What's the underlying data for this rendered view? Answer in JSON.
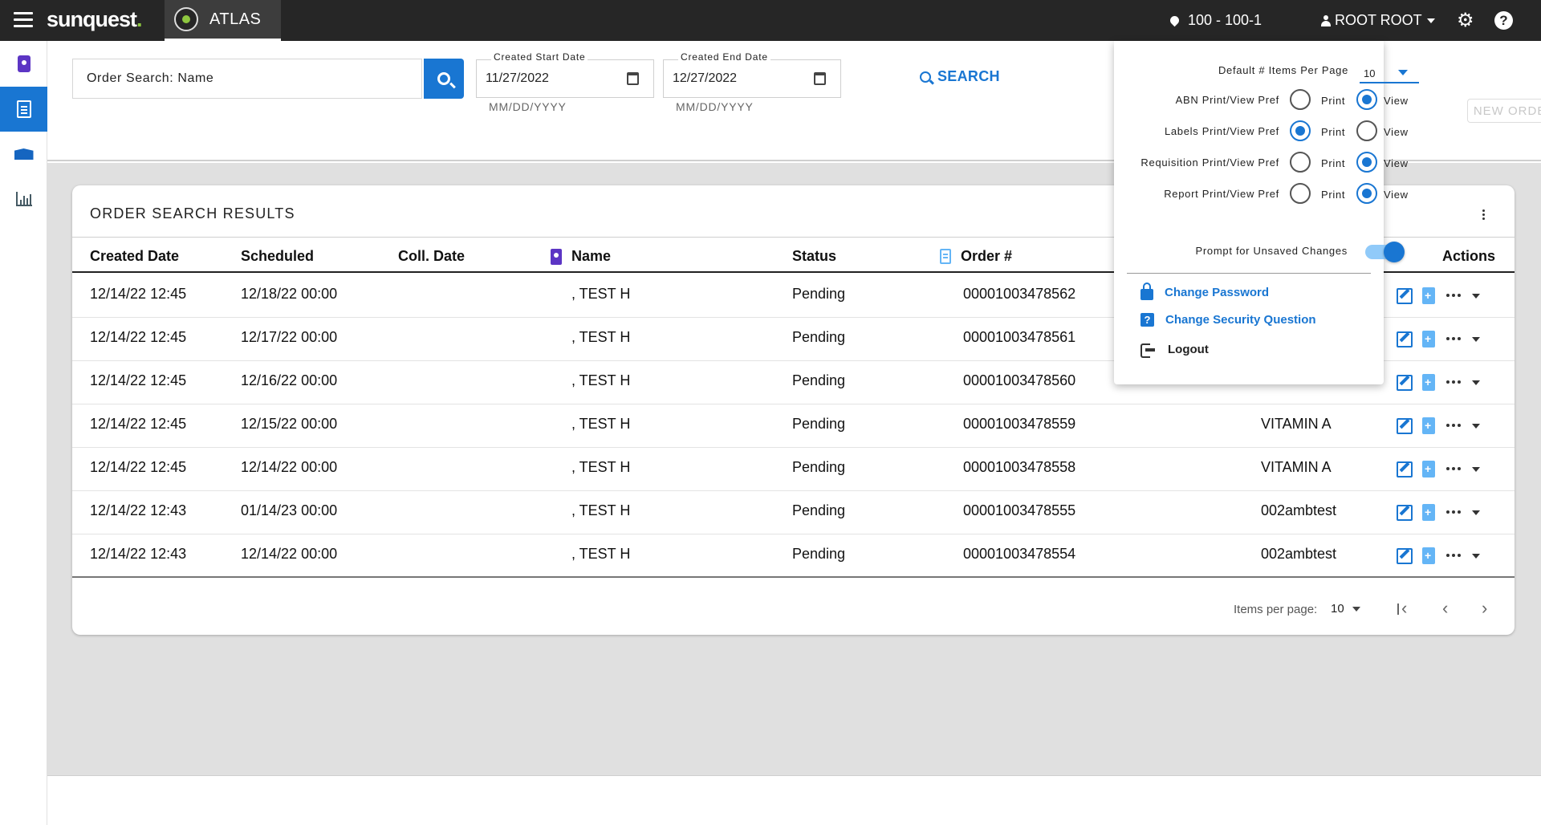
{
  "topbar": {
    "brand": "sunquest",
    "brand_dot": ".",
    "app_tab": "ATLAS",
    "location": "100 - 100-1",
    "user": "ROOT ROOT"
  },
  "search": {
    "placeholder": "Order Search: Name",
    "start_date_label": "Created Start Date",
    "start_date_value": "11/27/2022",
    "start_date_hint": "MM/DD/YYYY",
    "end_date_label": "Created End Date",
    "end_date_value": "12/27/2022",
    "end_date_hint": "MM/DD/YYYY",
    "search_label": "SEARCH",
    "new_order_label": "NEW ORDER"
  },
  "results": {
    "title": "ORDER SEARCH RESULTS",
    "columns": {
      "created": "Created Date",
      "scheduled": "Scheduled",
      "coll_date": "Coll. Date",
      "name": "Name",
      "status": "Status",
      "order": "Order #",
      "actions": "Actions"
    },
    "rows": [
      {
        "created": "12/14/22 12:45",
        "scheduled": "12/18/22 00:00",
        "coll_date": "",
        "name": ", TEST H",
        "status": "Pending",
        "order": "00001003478562",
        "test": ""
      },
      {
        "created": "12/14/22 12:45",
        "scheduled": "12/17/22 00:00",
        "coll_date": "",
        "name": ", TEST H",
        "status": "Pending",
        "order": "00001003478561",
        "test": ""
      },
      {
        "created": "12/14/22 12:45",
        "scheduled": "12/16/22 00:00",
        "coll_date": "",
        "name": ", TEST H",
        "status": "Pending",
        "order": "00001003478560",
        "test": ""
      },
      {
        "created": "12/14/22 12:45",
        "scheduled": "12/15/22 00:00",
        "coll_date": "",
        "name": ", TEST H",
        "status": "Pending",
        "order": "00001003478559",
        "test": "VITAMIN A"
      },
      {
        "created": "12/14/22 12:45",
        "scheduled": "12/14/22 00:00",
        "coll_date": "",
        "name": ", TEST H",
        "status": "Pending",
        "order": "00001003478558",
        "test": "VITAMIN A"
      },
      {
        "created": "12/14/22 12:43",
        "scheduled": "01/14/23 00:00",
        "coll_date": "",
        "name": ", TEST H",
        "status": "Pending",
        "order": "00001003478555",
        "test": "002ambtest"
      },
      {
        "created": "12/14/22 12:43",
        "scheduled": "12/14/22 00:00",
        "coll_date": "",
        "name": ", TEST H",
        "status": "Pending",
        "order": "00001003478554",
        "test": "002ambtest"
      }
    ],
    "pager": {
      "label": "Items per page:",
      "size": "10"
    }
  },
  "settings_panel": {
    "items_per_page_label": "Default # Items Per Page",
    "items_per_page_value": "10",
    "prefs": [
      {
        "label": "ABN Print/View Pref",
        "selected": "View"
      },
      {
        "label": "Labels Print/View Pref",
        "selected": "Print"
      },
      {
        "label": "Requisition Print/View Pref",
        "selected": "View"
      },
      {
        "label": "Report Print/View Pref",
        "selected": "View"
      }
    ],
    "print_label": "Print",
    "view_label": "View",
    "unsaved_label": "Prompt for Unsaved Changes",
    "unsaved_on": true,
    "change_password": "Change Password",
    "change_security": "Change Security Question",
    "logout": "Logout"
  },
  "colors": {
    "primary": "#1976d2",
    "topbar": "#262626",
    "accent_green": "#8dc63f",
    "purple": "#5c35c4"
  }
}
